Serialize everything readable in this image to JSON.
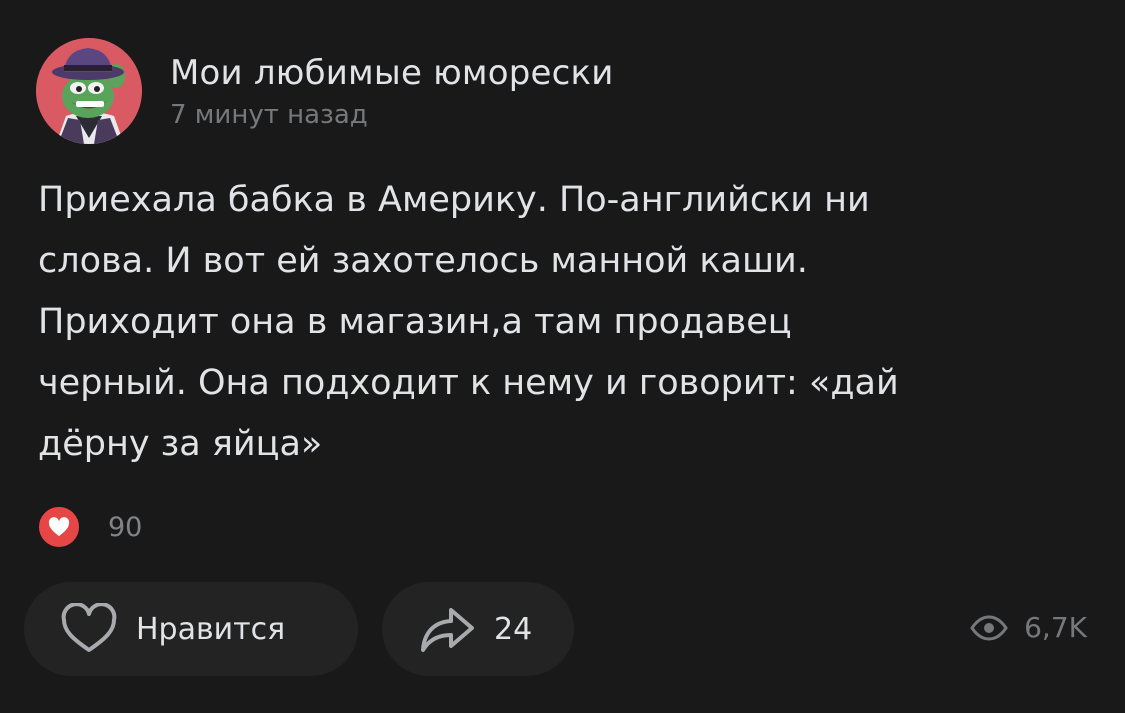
{
  "post": {
    "author": "Мои любимые юморески",
    "time": "7 минут назад",
    "text": "Приехала бабка в Америку. По-английски ни\nслова. И вот ей захотелось манной каши.\nПриходит она в магазин,а там продавец\nчерный. Она подходит к нему и говорит: «дай\nдёрну за яйца»",
    "reactions": {
      "icon": "heart-icon",
      "count": "90"
    },
    "actions": {
      "like_label": "Нравится",
      "share_count": "24"
    },
    "views": {
      "icon": "eye-icon",
      "count": "6,7K"
    }
  },
  "colors": {
    "background": "#19191a",
    "button": "#232324",
    "text": "#e1e3e6",
    "secondary": "#76787a",
    "heart": "#e64646"
  }
}
